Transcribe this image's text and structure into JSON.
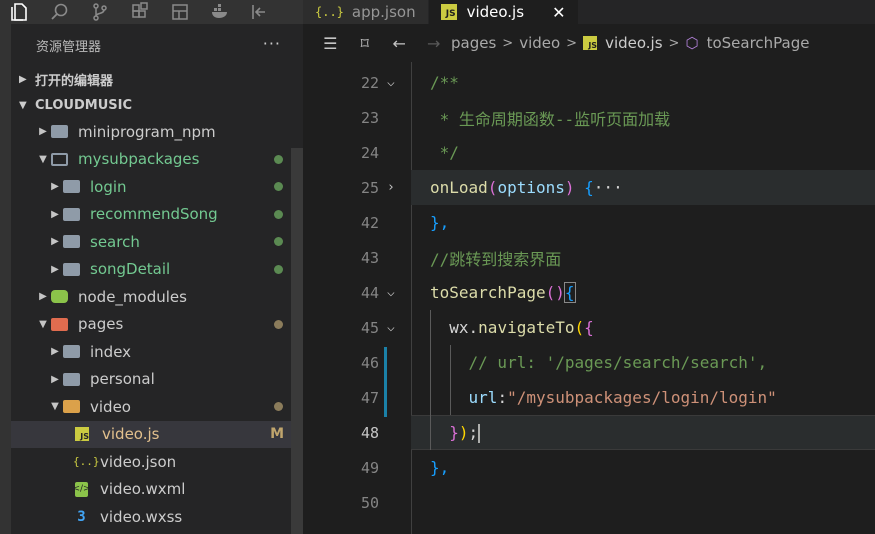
{
  "activity_icons": [
    "files-icon",
    "search-icon",
    "source-control-icon",
    "extensions-icon",
    "page-icon",
    "docker-icon",
    "collapse-panel-icon"
  ],
  "tabs": [
    {
      "label": "app.json",
      "icon": "{..}"
    },
    {
      "label": "video.js",
      "icon": "JS",
      "close": "✕"
    }
  ],
  "explorer": {
    "title": "资源管理器",
    "more": "···",
    "open_editors": "打开的编辑器",
    "project": "CLOUDMUSIC"
  },
  "tree": [
    {
      "label": "miniprogram_npm",
      "color": "normal"
    },
    {
      "label": "mysubpackages",
      "color": "green"
    },
    {
      "label": "login",
      "color": "green"
    },
    {
      "label": "recommendSong",
      "color": "green"
    },
    {
      "label": "search",
      "color": "green"
    },
    {
      "label": "songDetail",
      "color": "green"
    },
    {
      "label": "node_modules",
      "color": "normal"
    },
    {
      "label": "pages",
      "color": "normal"
    },
    {
      "label": "index",
      "color": "normal"
    },
    {
      "label": "personal",
      "color": "normal"
    },
    {
      "label": "video",
      "color": "normal"
    },
    {
      "label": "video.js",
      "color": "modified",
      "badge": "M"
    },
    {
      "label": "video.json",
      "color": "normal"
    },
    {
      "label": "video.wxml",
      "color": "normal"
    },
    {
      "label": "video.wxss",
      "color": "normal"
    }
  ],
  "breadcrumb": {
    "parts": [
      "pages",
      "video",
      "video.js",
      "toSearchPage"
    ],
    "separator": ">"
  },
  "editor": {
    "current_line": "48",
    "lines": [
      {
        "num": "22",
        "text": "/**"
      },
      {
        "num": "23",
        "text": " * 生命周期函数--监听页面加载"
      },
      {
        "num": "24",
        "text": " */"
      },
      {
        "num": "25",
        "text": "onLoad(options) {···"
      },
      {
        "num": "42",
        "text": "},"
      },
      {
        "num": "43",
        "text": "//跳转到搜索界面"
      },
      {
        "num": "44",
        "text": "toSearchPage(){"
      },
      {
        "num": "45",
        "text": "  wx.navigateTo({"
      },
      {
        "num": "46",
        "text": "    // url: '/pages/search/search',"
      },
      {
        "num": "47",
        "text": "    url:\"/mysubpackages/login/login\""
      },
      {
        "num": "48",
        "text": "  });"
      },
      {
        "num": "49",
        "text": "},"
      },
      {
        "num": "50",
        "text": ""
      }
    ]
  },
  "colors": {
    "accent_js": "#cbcb41",
    "git_added": "#73c991",
    "modified": "#c0a56d",
    "comment": "#6a9955",
    "function": "#dcdcaa"
  }
}
